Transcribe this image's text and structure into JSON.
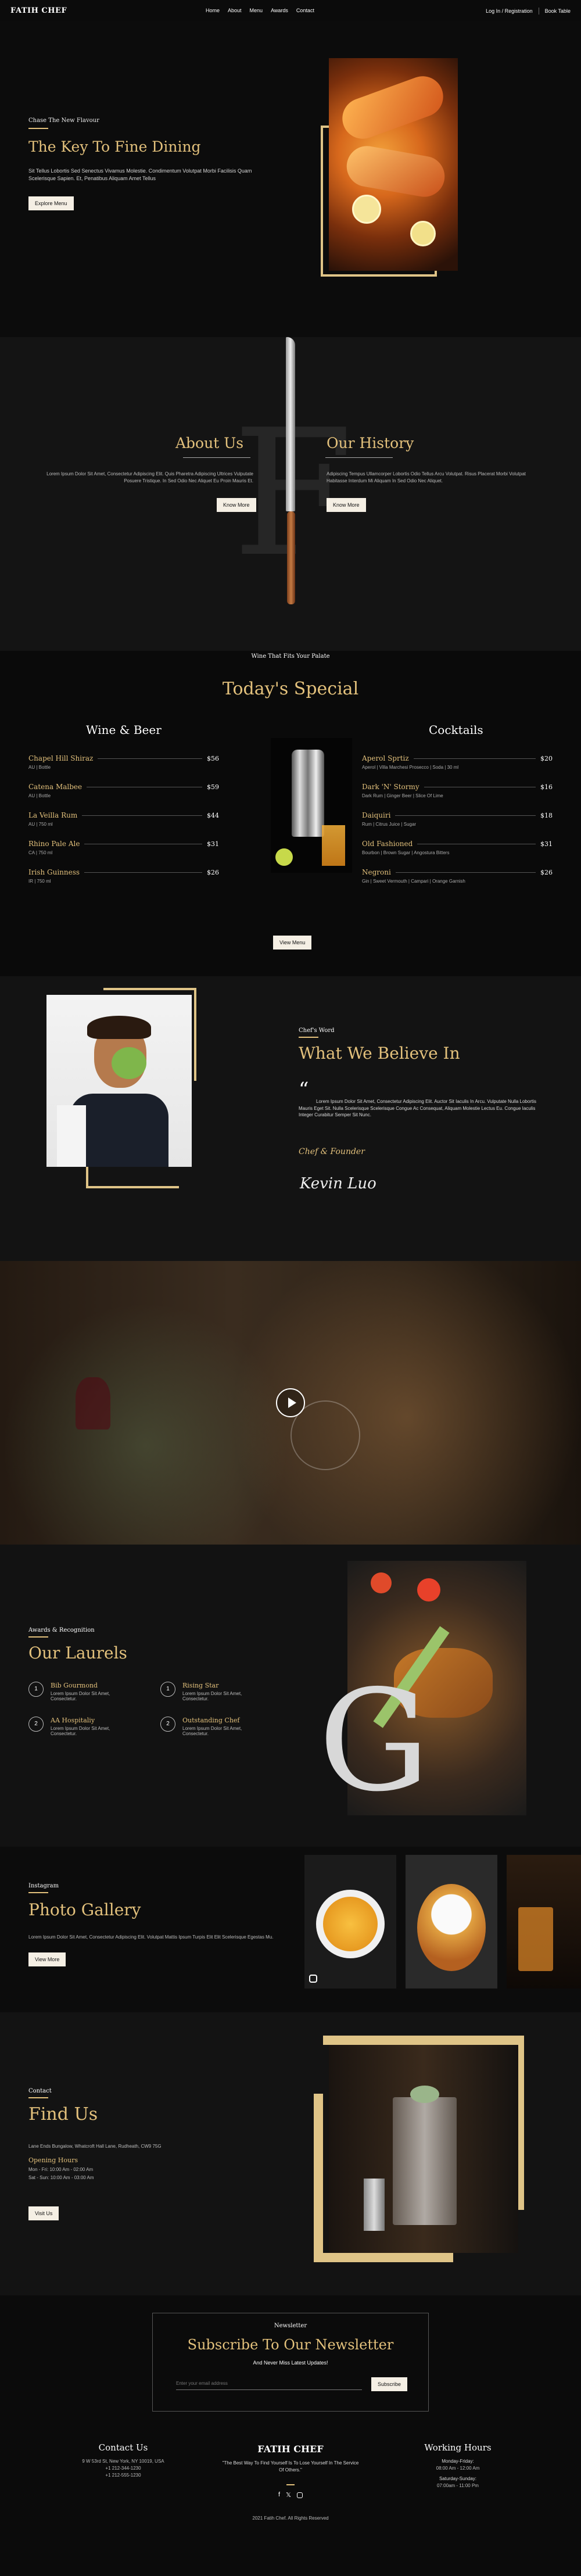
{
  "nav": {
    "logo": "FATIH CHEF",
    "links": [
      "Home",
      "About",
      "Menu",
      "Awards",
      "Contact"
    ],
    "login": "Log In / Registration",
    "book": "Book Table"
  },
  "hero": {
    "kicker": "Chase The New Flavour",
    "title": "The Key To Fine Dining",
    "text": "Sit Tellus Lobortis Sed Senectus Vivamus Molestie. Condimentum Volutpat Morbi Facilisis Quam Scelerisque Sapien. Et, Penatibus Aliquam Amet Tellus",
    "button": "Explore Menu"
  },
  "about": {
    "left_title": "About Us",
    "right_title": "Our History",
    "letter": "F",
    "left_text": "Lorem Ipsum Dolor Sit Amet, Consectetur Adipiscing Elit. Quis Pharetra Adipiscing Ultrices Vulputate Posuere Tristique. In Sed Odio Nec Aliquet Eu Proin Mauris Et.",
    "right_text": "Adipiscing Tempus Ullamcorper Lobortis Odio Tellus Arcu Volutpat. Risus Placerat Morbi Volutpat Habitasse Interdum Mi Aliquam In Sed Odio Nec Aliquet.",
    "left_button": "Know More",
    "right_button": "Know More"
  },
  "special": {
    "kicker": "Wine That Fits Your Palate",
    "title": "Today's Special",
    "wine_heading": "Wine & Beer",
    "cocktail_heading": "Cocktails",
    "button": "View Menu",
    "wine": [
      {
        "name": "Chapel Hill Shiraz",
        "desc": "AU | Bottle",
        "price": "$56"
      },
      {
        "name": "Catena Malbee",
        "desc": "AU | Bottle",
        "price": "$59"
      },
      {
        "name": "La Veilla Rum",
        "desc": "AU | 750 ml",
        "price": "$44"
      },
      {
        "name": "Rhino Pale Ale",
        "desc": "CA | 750 ml",
        "price": "$31"
      },
      {
        "name": "Irish Guinness",
        "desc": "IR | 750 ml",
        "price": "$26"
      }
    ],
    "cocktails": [
      {
        "name": "Aperol Sprtiz",
        "desc": "Aperol | Villa Marchesi Prosecco | Soda | 30 ml",
        "price": "$20"
      },
      {
        "name": "Dark 'N' Stormy",
        "desc": "Dark Rum | Ginger Beer | Slice Of Lime",
        "price": "$16"
      },
      {
        "name": "Daiquiri",
        "desc": "Rum | Citrus Juice | Sugar",
        "price": "$18"
      },
      {
        "name": "Old Fashioned",
        "desc": "Bourbon | Brown Sugar | Angostura Bitters",
        "price": "$31"
      },
      {
        "name": "Negroni",
        "desc": "Gin | Sweet Vermouth | Campari | Orange Garnish",
        "price": "$26"
      }
    ]
  },
  "chef": {
    "kicker": "Chef's Word",
    "title": "What We Believe In",
    "quote": "Lorem Ipsum Dolor Sit Amet, Consectetur Adipiscing Elit. Auctor Sit Iaculis In Arcu. Vulputate Nulla Lobortis Mauris Eget Sit. Nulla Scelerisque Scelerisque Congue Ac Consequat, Aliquam Molestie Lectus Eu. Congue Iaculis Integer Curabitur Semper Sit Nunc.",
    "role": "Chef & Founder",
    "signature": "Kevin Luo"
  },
  "awards": {
    "kicker": "Awards & Recognition",
    "title": "Our Laurels",
    "letter": "G",
    "items": [
      {
        "num": "1",
        "title": "Bib Gourmond",
        "text": "Lorem Ipsum Dolor Sit Amet, Consectetur."
      },
      {
        "num": "1",
        "title": "Rising Star",
        "text": "Lorem Ipsum Dolor Sit Amet, Consectetur."
      },
      {
        "num": "2",
        "title": "AA Hospitaliy",
        "text": "Lorem Ipsum Dolor Sit Amet, Consectetur."
      },
      {
        "num": "2",
        "title": "Outstanding Chef",
        "text": "Lorem Ipsum Dolor Sit Amet, Consectetur."
      }
    ]
  },
  "gallery": {
    "kicker": "Instagram",
    "title": "Photo Gallery",
    "text": "Lorem Ipsum Dolor Sit Amet, Consectetur Adipiscing Elit. Volutpat Mattis Ipsum Turpis Elit Elit Scelerisque Egestas Mu.",
    "button": "View More"
  },
  "contact": {
    "kicker": "Contact",
    "title": "Find Us",
    "address": "Lane Ends Bungalow, Whatcroft Hall Lane, Rudheath, CW9 75G",
    "hours_title": "Opening Hours",
    "hours": [
      "Mon - Fri: 10:00 Am - 02:00 Am",
      "Sat - Sun: 10:00 Am - 03:00 Am"
    ],
    "button": "Visit Us"
  },
  "newsletter": {
    "kicker": "Newsletter",
    "title": "Subscribe To Our Newsletter",
    "subtitle": "And Never Miss Latest Updates!",
    "placeholder": "Enter your email address",
    "button": "Subscribe"
  },
  "footer": {
    "contact_title": "Contact Us",
    "contact": [
      "9 W 53rd St, New York, NY 10019, USA",
      "+1 212-344-1230",
      "+1 212-555-1230"
    ],
    "logo": "FATIH CHEF",
    "quote": "\"The Best Way To Find Yourself Is To Lose Yourself In The Service Of Others.\"",
    "hours_title": "Working Hours",
    "hours": [
      "Monday-Friday:",
      "08:00 Am - 12:00 Am",
      "Saturday-Sunday:",
      "07:00am - 11:00 Pm"
    ],
    "copyright": "2021 Fatih Chef. All Rights Reserved"
  }
}
